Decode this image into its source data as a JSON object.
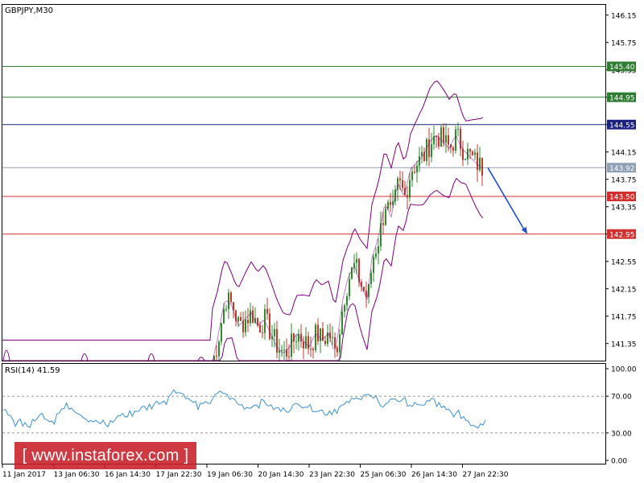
{
  "header": {
    "symbol_label": "GBPJPY,M30"
  },
  "indicator": {
    "label": "RSI(14) 41.59"
  },
  "watermark": {
    "text": "[  www.instaforex.com ]"
  },
  "colors": {
    "candle_up": "#2e8b2e",
    "candle_down": "#c0392b",
    "bollinger": "#800080",
    "rsi_line": "#3a8fd6",
    "arrow": "#1f4fd8",
    "level_green": "#2e7d32",
    "level_blue": "#1a237e",
    "level_red": "#d32f2f",
    "level_grey": "#8fa0b4"
  },
  "chart_data": [
    {
      "type": "candlestick",
      "ylim": [
        141.1,
        146.3
      ],
      "y_ticks": [
        "146.15",
        "145.75",
        "145.35",
        "144.95",
        "144.55",
        "144.15",
        "143.75",
        "143.35",
        "142.95",
        "142.55",
        "142.15",
        "141.75",
        "141.35"
      ],
      "x_ticks": [
        "11 Jan 2017",
        "13 Jan 06:30",
        "16 Jan 14:30",
        "17 Jan 22:30",
        "19 Jan 06:30",
        "20 Jan 14:30",
        "23 Jan 22:30",
        "25 Jan 06:30",
        "26 Jan 14:30",
        "27 Jan 22:30"
      ],
      "levels": [
        {
          "value": 145.4,
          "label": "145.40",
          "color": "#2e7d32"
        },
        {
          "value": 144.95,
          "label": "144.95",
          "color": "#2e7d32"
        },
        {
          "value": 144.55,
          "label": "144.55",
          "color": "#1a237e"
        },
        {
          "value": 143.92,
          "label": "143.92",
          "color": "#8fa0b4"
        },
        {
          "value": 143.5,
          "label": "143.50",
          "color": "#d32f2f"
        },
        {
          "value": 142.95,
          "label": "142.95",
          "color": "#d32f2f"
        }
      ],
      "close_path": [
        [
          0,
          140.9
        ],
        [
          40,
          140.6
        ],
        [
          80,
          140.7
        ],
        [
          120,
          140.8
        ],
        [
          160,
          140.9
        ],
        [
          200,
          140.8
        ],
        [
          240,
          140.9
        ],
        [
          262,
          141.0
        ],
        [
          270,
          141.4
        ],
        [
          276,
          141.8
        ],
        [
          280,
          142.0
        ],
        [
          288,
          141.9
        ],
        [
          296,
          141.6
        ],
        [
          304,
          141.7
        ],
        [
          312,
          141.8
        ],
        [
          320,
          141.6
        ],
        [
          328,
          141.7
        ],
        [
          336,
          141.5
        ],
        [
          344,
          141.3
        ],
        [
          352,
          141.2
        ],
        [
          360,
          141.3
        ],
        [
          368,
          141.5
        ],
        [
          376,
          141.4
        ],
        [
          384,
          141.3
        ],
        [
          392,
          141.5
        ],
        [
          400,
          141.4
        ],
        [
          408,
          141.5
        ],
        [
          416,
          141.2
        ],
        [
          420,
          141.5
        ],
        [
          426,
          142.0
        ],
        [
          432,
          142.3
        ],
        [
          440,
          142.5
        ],
        [
          448,
          142.2
        ],
        [
          456,
          142.0
        ],
        [
          462,
          142.6
        ],
        [
          470,
          142.9
        ],
        [
          478,
          143.4
        ],
        [
          486,
          143.2
        ],
        [
          494,
          143.7
        ],
        [
          502,
          143.5
        ],
        [
          510,
          143.9
        ],
        [
          518,
          144.0
        ],
        [
          526,
          144.1
        ],
        [
          534,
          144.3
        ],
        [
          542,
          144.4
        ],
        [
          550,
          144.3
        ],
        [
          558,
          144.2
        ],
        [
          566,
          144.4
        ],
        [
          574,
          144.2
        ],
        [
          582,
          144.1
        ],
        [
          590,
          144.0
        ],
        [
          598,
          143.92
        ]
      ],
      "projection_arrow": {
        "from": {
          "x_index": 606,
          "value": 143.92
        },
        "to": {
          "x_index": 655,
          "value": 142.95
        }
      }
    },
    {
      "type": "line",
      "title": "RSI(14) 41.59",
      "ylim": [
        0,
        100
      ],
      "y_ticks": [
        "100.00",
        "70.00",
        "30.00",
        "0.00"
      ],
      "dashed_levels": [
        70,
        30
      ],
      "values": [
        52,
        48,
        42,
        44,
        40,
        38,
        42,
        48,
        50,
        46,
        44,
        52,
        56,
        60,
        58,
        54,
        50,
        46,
        44,
        42,
        40,
        38,
        42,
        46,
        50,
        48,
        52,
        54,
        56,
        58,
        60,
        62,
        64,
        66,
        70,
        78,
        74,
        72,
        66,
        62,
        58,
        60,
        64,
        68,
        72,
        74,
        70,
        66,
        62,
        60,
        58,
        60,
        62,
        64,
        62,
        58,
        56,
        54,
        56,
        58,
        60,
        62,
        60,
        58,
        56,
        54,
        52,
        54,
        56,
        58,
        60,
        64,
        66,
        70,
        72,
        70,
        66,
        62,
        60,
        64,
        68,
        66,
        64,
        62,
        60,
        58,
        62,
        64,
        66,
        60,
        56,
        54,
        52,
        50,
        48,
        44,
        40,
        38,
        42,
        46
      ]
    }
  ]
}
